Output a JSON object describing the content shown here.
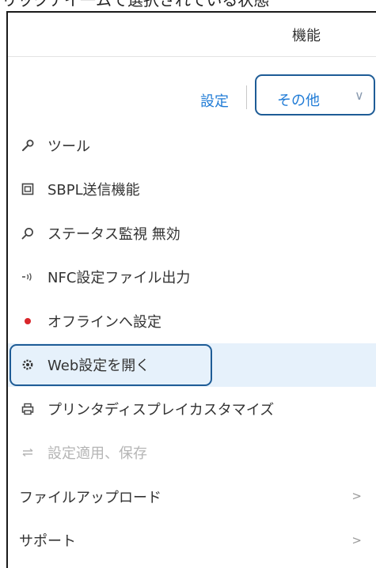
{
  "caption": "リックアイ一ムで選択されている状態",
  "header": {
    "title": "機能"
  },
  "tabs": {
    "settings_label": "設定",
    "other_label": "その他",
    "other_chevron": "∨"
  },
  "menu": {
    "items": [
      {
        "label": "ツール",
        "icon": "wrench-icon"
      },
      {
        "label": "SBPL送信機能",
        "icon": "document-icon"
      },
      {
        "label": "ステータス監視 無効",
        "icon": "magnifier-icon"
      },
      {
        "label": "NFC設定ファイル出力",
        "icon": "nfc-icon"
      },
      {
        "label": "オフラインへ設定",
        "icon": "status-dot-icon",
        "status_color": "#d9262b"
      },
      {
        "label": "Web設定を開く",
        "icon": "gear-icon",
        "selected": true
      },
      {
        "label": "プリンタディスプレイカスタマイズ",
        "icon": "printer-icon"
      },
      {
        "label": "設定適用、保存",
        "icon": "apply-arrows-icon",
        "disabled": true
      },
      {
        "label": "ファイルアップロード",
        "arrow": ">"
      },
      {
        "label": "サポート",
        "arrow": ">"
      }
    ]
  },
  "colors": {
    "accent": "#1f7bd6",
    "focus_outline": "#1e5c96",
    "selected_background": "#e6f1fb",
    "disabled_text": "#b5b5b5"
  }
}
